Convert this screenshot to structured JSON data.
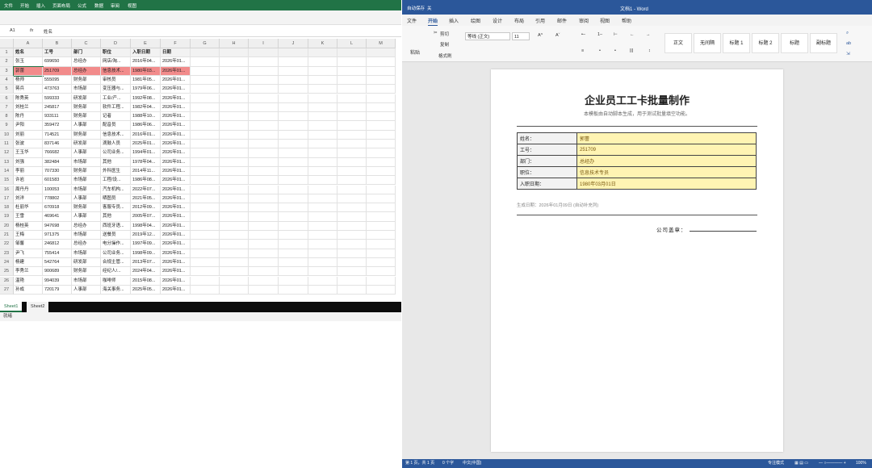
{
  "excel": {
    "menu": [
      "文件",
      "开始",
      "插入",
      "页面布局",
      "公式",
      "数据",
      "审阅",
      "视图"
    ],
    "name_box": "A1",
    "fx_label": "fx",
    "formula_value": "姓名",
    "columns": [
      "A",
      "B",
      "C",
      "D",
      "E",
      "F",
      "G",
      "H",
      "I",
      "J",
      "K",
      "L",
      "M"
    ],
    "header_row": [
      "姓名",
      "工号",
      "部门",
      "职位",
      "入职日期",
      "日期"
    ],
    "rows": [
      [
        "张玉",
        "699650",
        "总经办",
        "网店/淘...",
        "2016年04...",
        "2026年01..."
      ],
      [
        "郭蕾",
        "251709",
        "总经办",
        "信息技术...",
        "1980年03...",
        "2026年01..."
      ],
      [
        "杨帅",
        "555095",
        "财务部",
        "审核员",
        "1981年05...",
        "2026年01..."
      ],
      [
        "蒋兵",
        "473763",
        "市场部",
        "变压器与...",
        "1979年06...",
        "2026年01..."
      ],
      [
        "陈秀英",
        "599333",
        "研发部",
        "工业/产...",
        "1992年08...",
        "2026年01..."
      ],
      [
        "刘桂兰",
        "245817",
        "财务部",
        "软件工程...",
        "1982年04...",
        "2026年01..."
      ],
      [
        "陈丹",
        "933111",
        "财务部",
        "记者",
        "1988年10...",
        "2026年01..."
      ],
      [
        "尹阳",
        "359472",
        "人事部",
        "配音员",
        "1986年06...",
        "2026年01..."
      ],
      [
        "刘丽",
        "714521",
        "财务部",
        "信息技术...",
        "2016年01...",
        "2026年01..."
      ],
      [
        "张波",
        "837146",
        "研发部",
        "滴鼓人员",
        "2025年01...",
        "2026年01..."
      ],
      [
        "王玉华",
        "766682",
        "人事部",
        "公司业务...",
        "1994年01...",
        "2026年01..."
      ],
      [
        "刘强",
        "382484",
        "市场部",
        "其他",
        "1978年04...",
        "2026年01..."
      ],
      [
        "李丽",
        "707330",
        "财务部",
        "外科医生",
        "2014年11...",
        "2026年01..."
      ],
      [
        "许岩",
        "601583",
        "市场部",
        "工程/设...",
        "1986年08...",
        "2026年01..."
      ],
      [
        "周丹丹",
        "100053",
        "市场部",
        "汽车机构...",
        "2022年07...",
        "2026年01..."
      ],
      [
        "刘洋",
        "778802",
        "人事部",
        "晒图员",
        "2021年05...",
        "2026年01..."
      ],
      [
        "杜丽华",
        "670918",
        "财务部",
        "客服专员...",
        "2012年09...",
        "2026年01..."
      ],
      [
        "王雪",
        "469641",
        "人事部",
        "其他",
        "2005年07...",
        "2026年01..."
      ],
      [
        "杨桂英",
        "947698",
        "总经办",
        "西班牙语...",
        "1998年04...",
        "2026年01..."
      ],
      [
        "王梅",
        "971375",
        "市场部",
        "送餐员",
        "2019年12...",
        "2026年01..."
      ],
      [
        "邹馨",
        "246812",
        "总经办",
        "电分操作...",
        "1997年09...",
        "2026年01..."
      ],
      [
        "尹飞",
        "755414",
        "市场部",
        "公司业务...",
        "1998年09...",
        "2026年01..."
      ],
      [
        "杨建",
        "542764",
        "研发部",
        "合规主管...",
        "2013年07...",
        "2026年01..."
      ],
      [
        "李秀兰",
        "900689",
        "财务部",
        "经纪人/...",
        "2024年04...",
        "2026年01..."
      ],
      [
        "温艳",
        "994039",
        "市场部",
        "咖啡师",
        "2015年08...",
        "2026年01..."
      ],
      [
        "孙成",
        "720179",
        "人事部",
        "海关事务...",
        "2025年05...",
        "2026年01..."
      ]
    ],
    "sheets": [
      "Sheet1",
      "Sheet2"
    ],
    "status": "就绪"
  },
  "word": {
    "autosave": "自动保存",
    "autosave_state": "关",
    "title": "文档1 - Word",
    "menu": [
      "文件",
      "开始",
      "插入",
      "绘图",
      "设计",
      "布局",
      "引用",
      "邮件",
      "审阅",
      "视图",
      "帮助"
    ],
    "ribbon": {
      "paste": "粘贴",
      "cut": "剪切",
      "copy": "复制",
      "format_painter": "格式刷",
      "font_name": "等线 (正文)",
      "font_size": "11",
      "styles": [
        "正文",
        "无间隔",
        "标题 1",
        "标题 2",
        "标题",
        "副标题"
      ]
    },
    "doc": {
      "title": "企业员工工卡批量制作",
      "subtitle": "本模板由自动脚本生成，用于测试批量填空功能。",
      "fields": [
        {
          "label": "姓名：",
          "value": "郭蕾"
        },
        {
          "label": "工号：",
          "value": "251709"
        },
        {
          "label": "部门：",
          "value": "总经办"
        },
        {
          "label": "职位：",
          "value": "信息技术专员"
        },
        {
          "label": "入职日期：",
          "value": "1980年03月01日"
        }
      ],
      "gen_date": "生成日期：2026年01月09日 (自动补充列)",
      "seal": "公司盖章："
    },
    "status": {
      "page": "第 1 页，共 1 页",
      "words": "0 个字",
      "lang": "中文(中国)",
      "focus": "专注模式",
      "zoom": "100%"
    }
  }
}
